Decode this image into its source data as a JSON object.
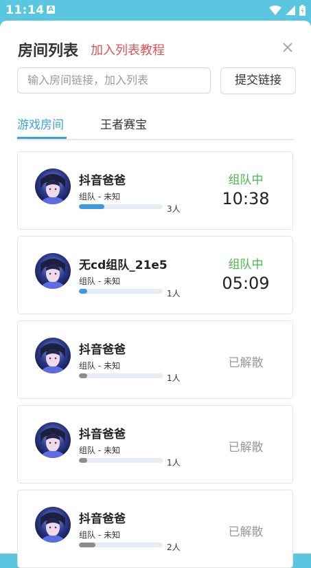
{
  "status_bar": {
    "time": "11:14",
    "notif": "A"
  },
  "header": {
    "title": "房间列表",
    "tutorial_link": "加入列表教程"
  },
  "search": {
    "placeholder": "输入房间链接，加入列表",
    "value": "",
    "submit_label": "提交链接"
  },
  "tabs": [
    {
      "label": "游戏房间",
      "active": true
    },
    {
      "label": "王者赛宝",
      "active": false
    }
  ],
  "colors": {
    "accent": "#3ea2d9",
    "active_green": "#4ab84a",
    "link_red": "#e05353",
    "bar_blue": "#3e97e0",
    "bar_gray": "#8c8c8c"
  },
  "rooms": [
    {
      "name": "抖音爸爸",
      "sub": "组队 - 未知",
      "count": "3人",
      "status": "组队中",
      "time": "10:38",
      "progress": 0.3,
      "state": "active"
    },
    {
      "name": "无cd组队_21e5",
      "sub": "组队 - 未知",
      "count": "1人",
      "status": "组队中",
      "time": "05:09",
      "progress": 0.1,
      "state": "active"
    },
    {
      "name": "抖音爸爸",
      "sub": "组队 - 未知",
      "count": "1人",
      "status": "已解散",
      "time": "",
      "progress": 0.1,
      "state": "dissolved"
    },
    {
      "name": "抖音爸爸",
      "sub": "组队 - 未知",
      "count": "1人",
      "status": "已解散",
      "time": "",
      "progress": 0.1,
      "state": "dissolved"
    },
    {
      "name": "抖音爸爸",
      "sub": "组队 - 未知",
      "count": "2人",
      "status": "已解散",
      "time": "",
      "progress": 0.2,
      "state": "dissolved"
    }
  ]
}
